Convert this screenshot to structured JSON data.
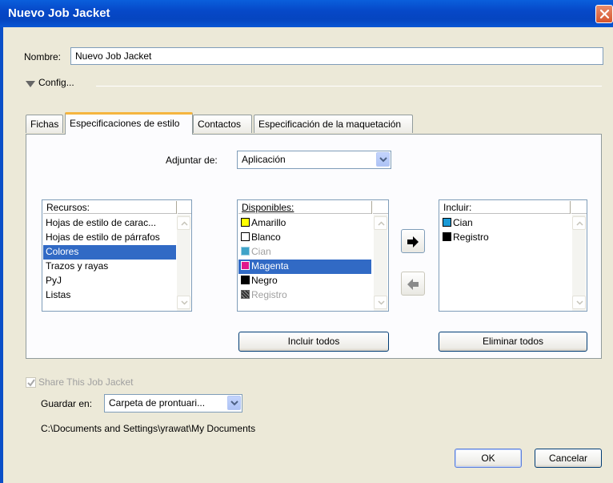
{
  "window": {
    "title": "Nuevo Job Jacket"
  },
  "name_field": {
    "label": "Nombre:",
    "value": "Nuevo Job Jacket"
  },
  "config": {
    "label": "Config..."
  },
  "tabs": [
    {
      "label": "Fichas"
    },
    {
      "label": "Especificaciones de estilo"
    },
    {
      "label": "Contactos"
    },
    {
      "label": "Especificación de la maquetación"
    }
  ],
  "attach": {
    "label": "Adjuntar de:",
    "value": "Aplicación"
  },
  "resources": {
    "header": "Recursos:",
    "items": [
      {
        "label": "Hojas de estilo de carac..."
      },
      {
        "label": "Hojas de estilo de párrafos"
      },
      {
        "label": "Colores",
        "selected": true
      },
      {
        "label": "Trazos y rayas"
      },
      {
        "label": "PyJ"
      },
      {
        "label": "Listas"
      }
    ]
  },
  "available": {
    "header": "Disponibles:",
    "items": [
      {
        "label": "Amarillo",
        "color": "#ffff00"
      },
      {
        "label": "Blanco",
        "color": "#ffffff"
      },
      {
        "label": "Cian",
        "color": "#3fa3c8",
        "disabled": true
      },
      {
        "label": "Magenta",
        "color": "#e0188c",
        "selected": true
      },
      {
        "label": "Negro",
        "color": "#000000"
      },
      {
        "label": "Registro",
        "color": "#444444",
        "disabled": true
      }
    ]
  },
  "include": {
    "header": "Incluir:",
    "items": [
      {
        "label": "Cian",
        "color": "#1a9ad6"
      },
      {
        "label": "Registro",
        "color": "#000000"
      }
    ]
  },
  "buttons": {
    "include_all": "Incluir todos",
    "remove_all": "Eliminar todos",
    "ok": "OK",
    "cancel": "Cancelar"
  },
  "share": {
    "label": "Share This Job Jacket",
    "checked": true
  },
  "save_in": {
    "label": "Guardar en:",
    "value": "Carpeta de prontuari..."
  },
  "path": "C:\\Documents and Settings\\yrawat\\My Documents",
  "colors": {
    "title_bar": "#0548c4",
    "selection": "#316ac5",
    "tab_accent": "#f5b53f",
    "close": "#d6552e"
  }
}
